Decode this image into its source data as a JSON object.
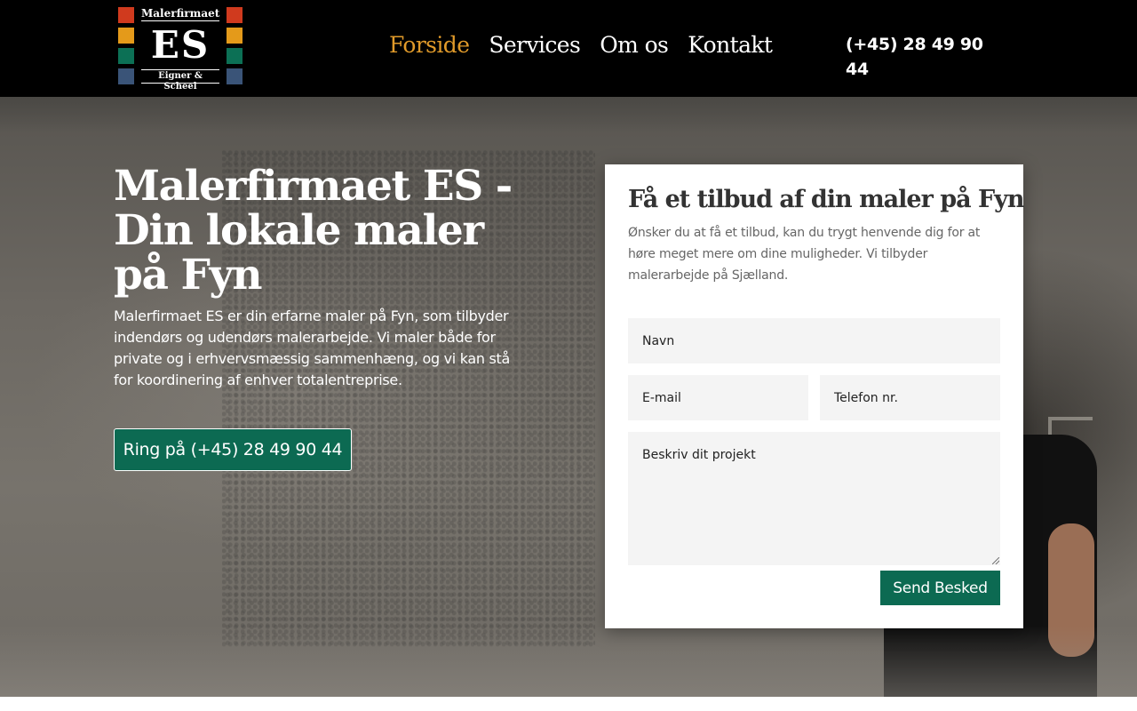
{
  "header": {
    "logo": {
      "top_text": "Malerfirmaet",
      "main_text": "ES",
      "bottom_text": "Eigner & Scheel",
      "square_colors": [
        "#d03a1e",
        "#e49a1a",
        "#0c7055",
        "#3a5478"
      ]
    },
    "nav": [
      {
        "label": "Forside",
        "active": true
      },
      {
        "label": "Services",
        "active": false
      },
      {
        "label": "Om os",
        "active": false
      },
      {
        "label": "Kontakt",
        "active": false
      }
    ],
    "phone": "(+45) 28 49 90 44"
  },
  "hero": {
    "title": "Malerfirmaet ES - Din lokale maler på Fyn",
    "text": "Malerfirmaet ES er din erfarne maler på Fyn, som tilbyder indendørs og udendørs malerarbejde. Vi maler både for private og i erhvervsmæssig sammenhæng, og vi kan stå for koordinering af enhver totalentreprise.",
    "cta_label": "Ring på (+45) 28 49 90 44"
  },
  "form": {
    "title": "Få et tilbud af din maler på Fyn",
    "text": "Ønsker du at få et tilbud, kan du trygt henvende dig for at høre meget mere om dine muligheder. Vi tilbyder malerarbejde på Sjælland.",
    "name_placeholder": "Navn",
    "email_placeholder": "E-mail",
    "phone_placeholder": "Telefon nr.",
    "message_placeholder": "Beskriv dit projekt",
    "submit_label": "Send Besked"
  },
  "colors": {
    "accent_green": "#0c6a52",
    "nav_active": "#e09a2a",
    "header_bg": "#000000"
  }
}
